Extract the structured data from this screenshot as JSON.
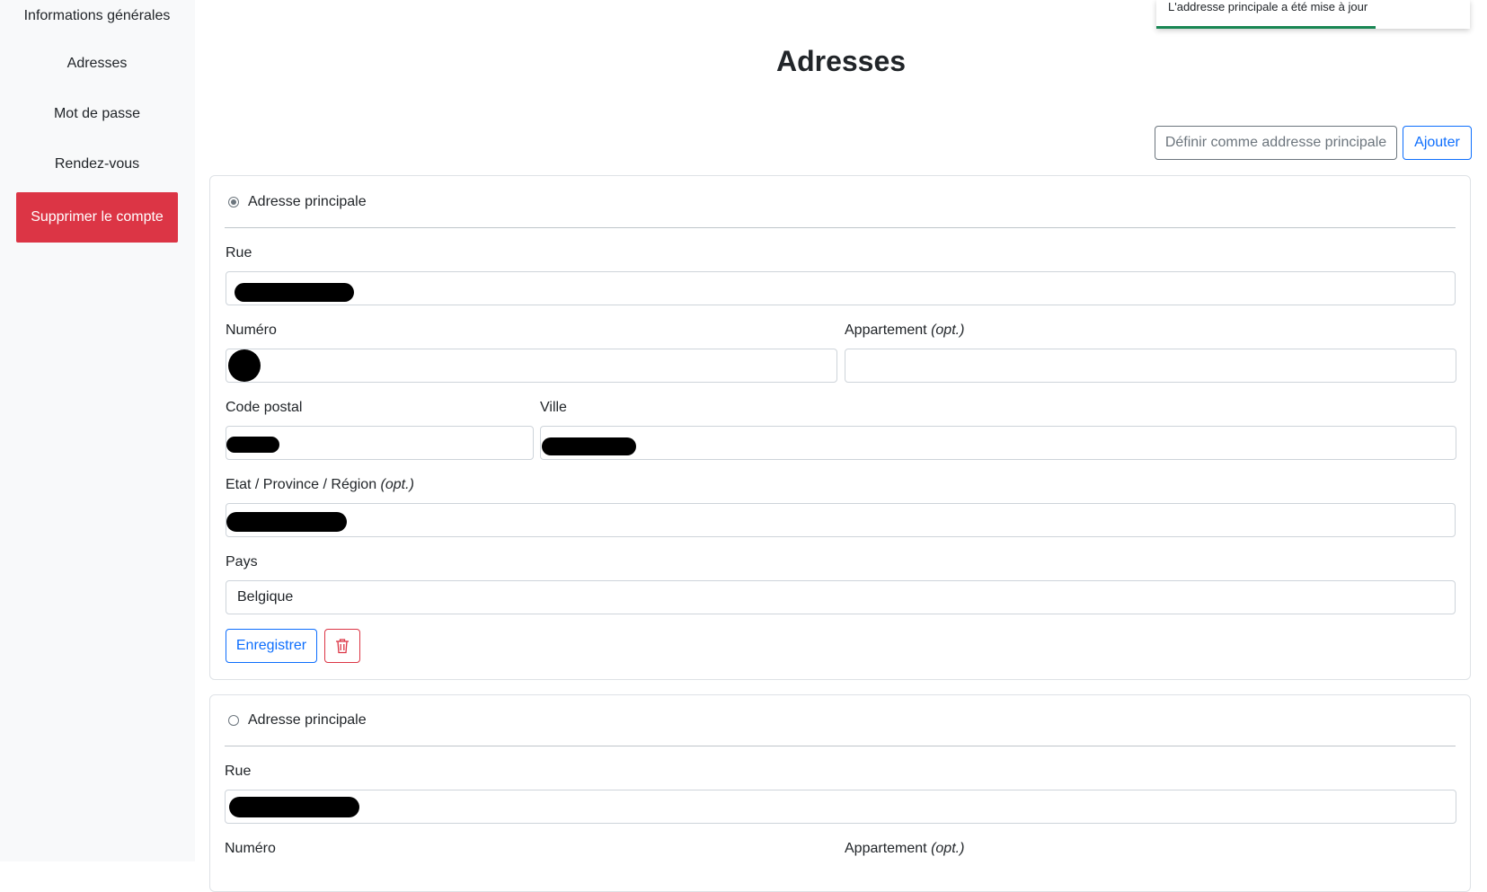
{
  "sidebar": {
    "items": [
      {
        "label": "Informations générales"
      },
      {
        "label": "Adresses"
      },
      {
        "label": "Mot de passe"
      },
      {
        "label": "Rendez-vous"
      },
      {
        "label": "Supprimer le compte"
      }
    ]
  },
  "toast": {
    "message": "L'addresse principale a été mise à jour",
    "progress": 0.7
  },
  "page": {
    "title": "Adresses"
  },
  "actions": {
    "set_primary_label": "Définir comme addresse principale",
    "add_label": "Ajouter"
  },
  "labels": {
    "primary": "Adresse principale",
    "street": "Rue",
    "number": "Numéro",
    "apartment": "Appartement",
    "optional": "(opt.)",
    "postal_code": "Code postal",
    "city": "Ville",
    "state": "Etat / Province / Région",
    "country": "Pays",
    "save": "Enregistrer"
  },
  "addresses": [
    {
      "primary": true,
      "country": "Belgique"
    },
    {
      "primary": false
    }
  ],
  "colors": {
    "danger": "#dc3545",
    "primary": "#0d6efd",
    "success": "#198754"
  },
  "icons": {
    "delete": "trash-icon"
  }
}
